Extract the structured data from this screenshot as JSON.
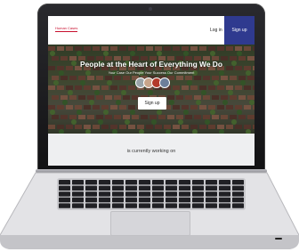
{
  "site": {
    "logo_text": "Human Cases",
    "nav": {
      "login": "Log in",
      "signup": "Sign up"
    },
    "hero": {
      "title": "People at the Heart of Everything We Do",
      "subtitle": "Your Case  Our People  Your Success  Our Commitment",
      "cta": "Sign up"
    },
    "band_text": "is currently working on"
  },
  "colors": {
    "brand_red": "#c8102e",
    "signup_blue": "#2f3a8f",
    "laptop_bezel": "#1c1c1e",
    "band_gray": "#eeeff1"
  }
}
